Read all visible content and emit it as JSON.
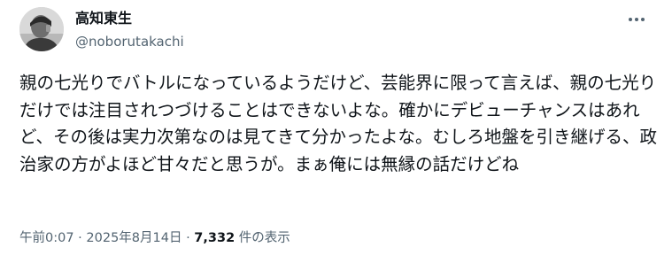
{
  "author": {
    "display_name": "高知東生",
    "handle": "@noborutakachi"
  },
  "tweet": {
    "text": "親の七光りでバトルになっているようだけど、芸能界に限って言えば、親の七光りだけでは注目されつづけることはできないよな。確かにデビューチャンスはあれど、その後は実力次第なのは見てきて分かったよな。むしろ地盤を引き継げる、政治家の方がよほど甘々だと思うが。まぁ俺には無縁の話だけどね"
  },
  "meta": {
    "time": "午前0:07",
    "separator": "·",
    "date": "2025年8月14日",
    "views_count": "7,332",
    "views_label": "件の表示"
  },
  "icons": {
    "more": "more-horizontal-icon",
    "avatar": "avatar"
  },
  "colors": {
    "text": "#0f1419",
    "secondary": "#536471",
    "background": "#ffffff"
  }
}
